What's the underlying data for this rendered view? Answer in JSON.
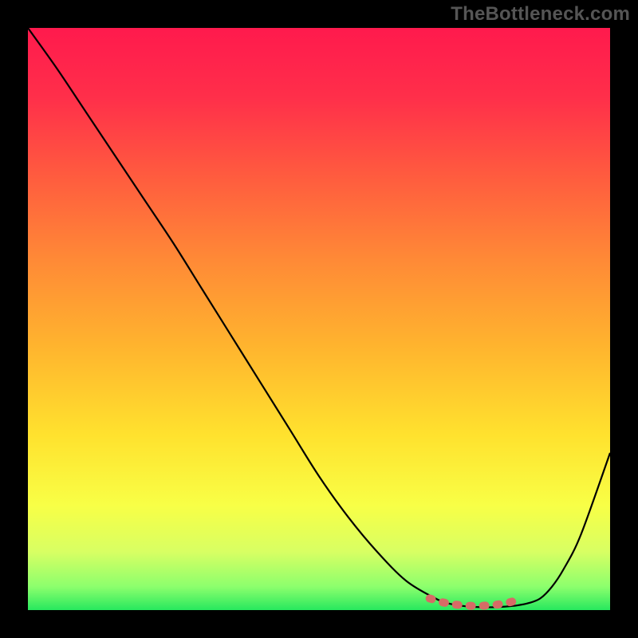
{
  "watermark": "TheBottleneck.com",
  "chart_data": {
    "type": "line",
    "title": "",
    "xlabel": "",
    "ylabel": "",
    "xlim": [
      0,
      100
    ],
    "ylim": [
      0,
      100
    ],
    "grid": false,
    "legend": false,
    "series": [
      {
        "name": "bottleneck-curve",
        "color": "#000000",
        "x": [
          0,
          5,
          10,
          15,
          20,
          25,
          30,
          35,
          40,
          45,
          50,
          55,
          60,
          65,
          70,
          72,
          74,
          76,
          78,
          80,
          82,
          84,
          86,
          88,
          90,
          92,
          95,
          100
        ],
        "y": [
          100,
          93,
          85.5,
          78,
          70.5,
          63,
          55,
          47,
          39,
          31,
          23,
          16,
          10,
          5,
          2,
          1.2,
          0.8,
          0.6,
          0.5,
          0.5,
          0.6,
          0.8,
          1.2,
          2,
          4,
          7,
          13,
          27
        ]
      },
      {
        "name": "bottom-marker",
        "color": "#d66b66",
        "x": [
          69,
          71,
          73,
          75,
          77,
          79,
          81,
          83,
          85
        ],
        "y": [
          2.0,
          1.4,
          1.0,
          0.8,
          0.7,
          0.8,
          1.0,
          1.4,
          2.0
        ]
      }
    ],
    "gradient_stops": [
      {
        "offset": 0.0,
        "color": "#ff1a4d"
      },
      {
        "offset": 0.12,
        "color": "#ff2f4a"
      },
      {
        "offset": 0.25,
        "color": "#ff5a3f"
      },
      {
        "offset": 0.4,
        "color": "#ff8a36"
      },
      {
        "offset": 0.55,
        "color": "#ffb52e"
      },
      {
        "offset": 0.7,
        "color": "#ffe22e"
      },
      {
        "offset": 0.82,
        "color": "#f8ff46"
      },
      {
        "offset": 0.9,
        "color": "#d8ff63"
      },
      {
        "offset": 0.96,
        "color": "#8cff6d"
      },
      {
        "offset": 1.0,
        "color": "#27e85e"
      }
    ]
  }
}
